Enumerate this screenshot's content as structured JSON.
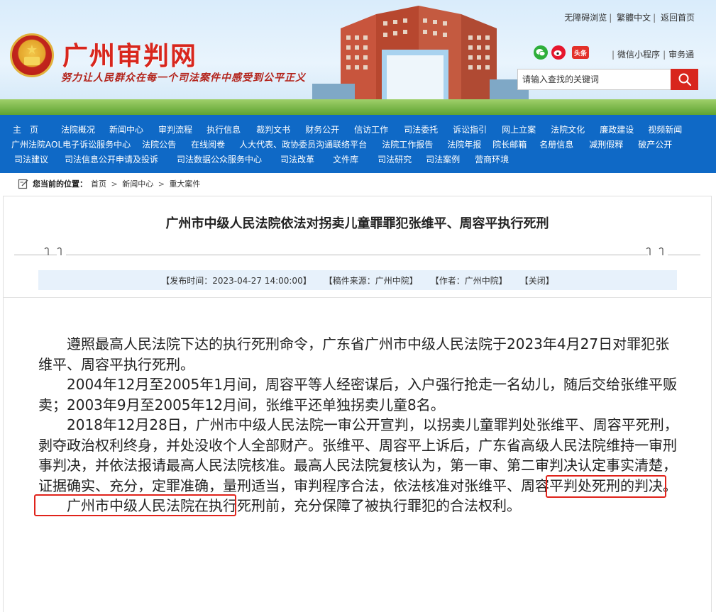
{
  "header": {
    "site_title": "广州审判网",
    "slogan": "努力让人民群众在每一个司法案件中感受到公平正义",
    "top_links": [
      "无障碍浏览",
      "繁體中文",
      "返回首页"
    ],
    "mini_links": [
      "微信小程序",
      "审务通"
    ],
    "social_icons": [
      "wechat-icon",
      "weibo-icon",
      "toutiao-icon"
    ],
    "toutiao_label": "头条",
    "search_placeholder": "请输入查找的关键词"
  },
  "nav": {
    "row1": [
      "主　页",
      "法院概况",
      "新闻中心",
      "审判流程",
      "执行信息",
      "裁判文书",
      "财务公开",
      "信访工作",
      "司法委托",
      "诉讼指引",
      "网上立案",
      "法院文化",
      "廉政建设",
      "视频新闻"
    ],
    "row2": [
      "广州法院AOL电子诉讼服务中心",
      "法院公告",
      "在线阅卷",
      "人大代表、政协委员沟通联络平台",
      "法院工作报告",
      "法院年报",
      "院长邮箱",
      "名册信息",
      "减刑假释",
      "破产公开"
    ],
    "row3": [
      "司法建议",
      "司法信息公开申请及投诉",
      "司法数据公众服务中心",
      "司法改革",
      "文件库",
      "司法研究",
      "司法案例",
      "营商环境"
    ]
  },
  "breadcrumb": {
    "label": "您当前的位置：",
    "items": [
      "首页",
      "新闻中心",
      "重大案件"
    ],
    "separator": ">"
  },
  "article": {
    "title": "广州市中级人民法院依法对拐卖儿童罪罪犯张维平、周容平执行死刑",
    "meta": {
      "publish_time": "【发布时间：2023-04-27 14:00:00】",
      "source": "【稿件来源：广州中院】",
      "author": "【作者：广州中院】",
      "close": "【关闭】"
    },
    "paragraphs": [
      "遵照最高人民法院下达的执行死刑命令，广东省广州市中级人民法院于2023年4月27日对罪犯张维平、周容平执行死刑。",
      "2004年12月至2005年1月间，周容平等人经密谋后，入户强行抢走一名幼儿，随后交给张维平贩卖；2003年9月至2005年12月间，张维平还单独拐卖儿童8名。",
      "2018年12月28日，广州市中级人民法院一审公开宣判，以拐卖儿童罪判处张维平、周容平死刑，剥夺政治权利终身，并处没收个人全部财产。张维平、周容平上诉后，广东省高级人民法院维持一审刑事判决，并依法报请最高人民法院核准。最高人民法院复核认为，第一审、第二审判决认定事实清楚，证据确实、充分，定罪准确，量刑适当，审判程序合法，",
      "依法核准对张维平、周容平判处死刑的判决。",
      "广州市中级人民法院在执行死刑前，充分保障了被执行罪犯的合法权利。"
    ]
  },
  "colors": {
    "nav_bg": "#0f69c6",
    "brand_red": "#d8261d",
    "highlight_box": "#e0231b",
    "meta_bg": "#e7f1fb"
  }
}
